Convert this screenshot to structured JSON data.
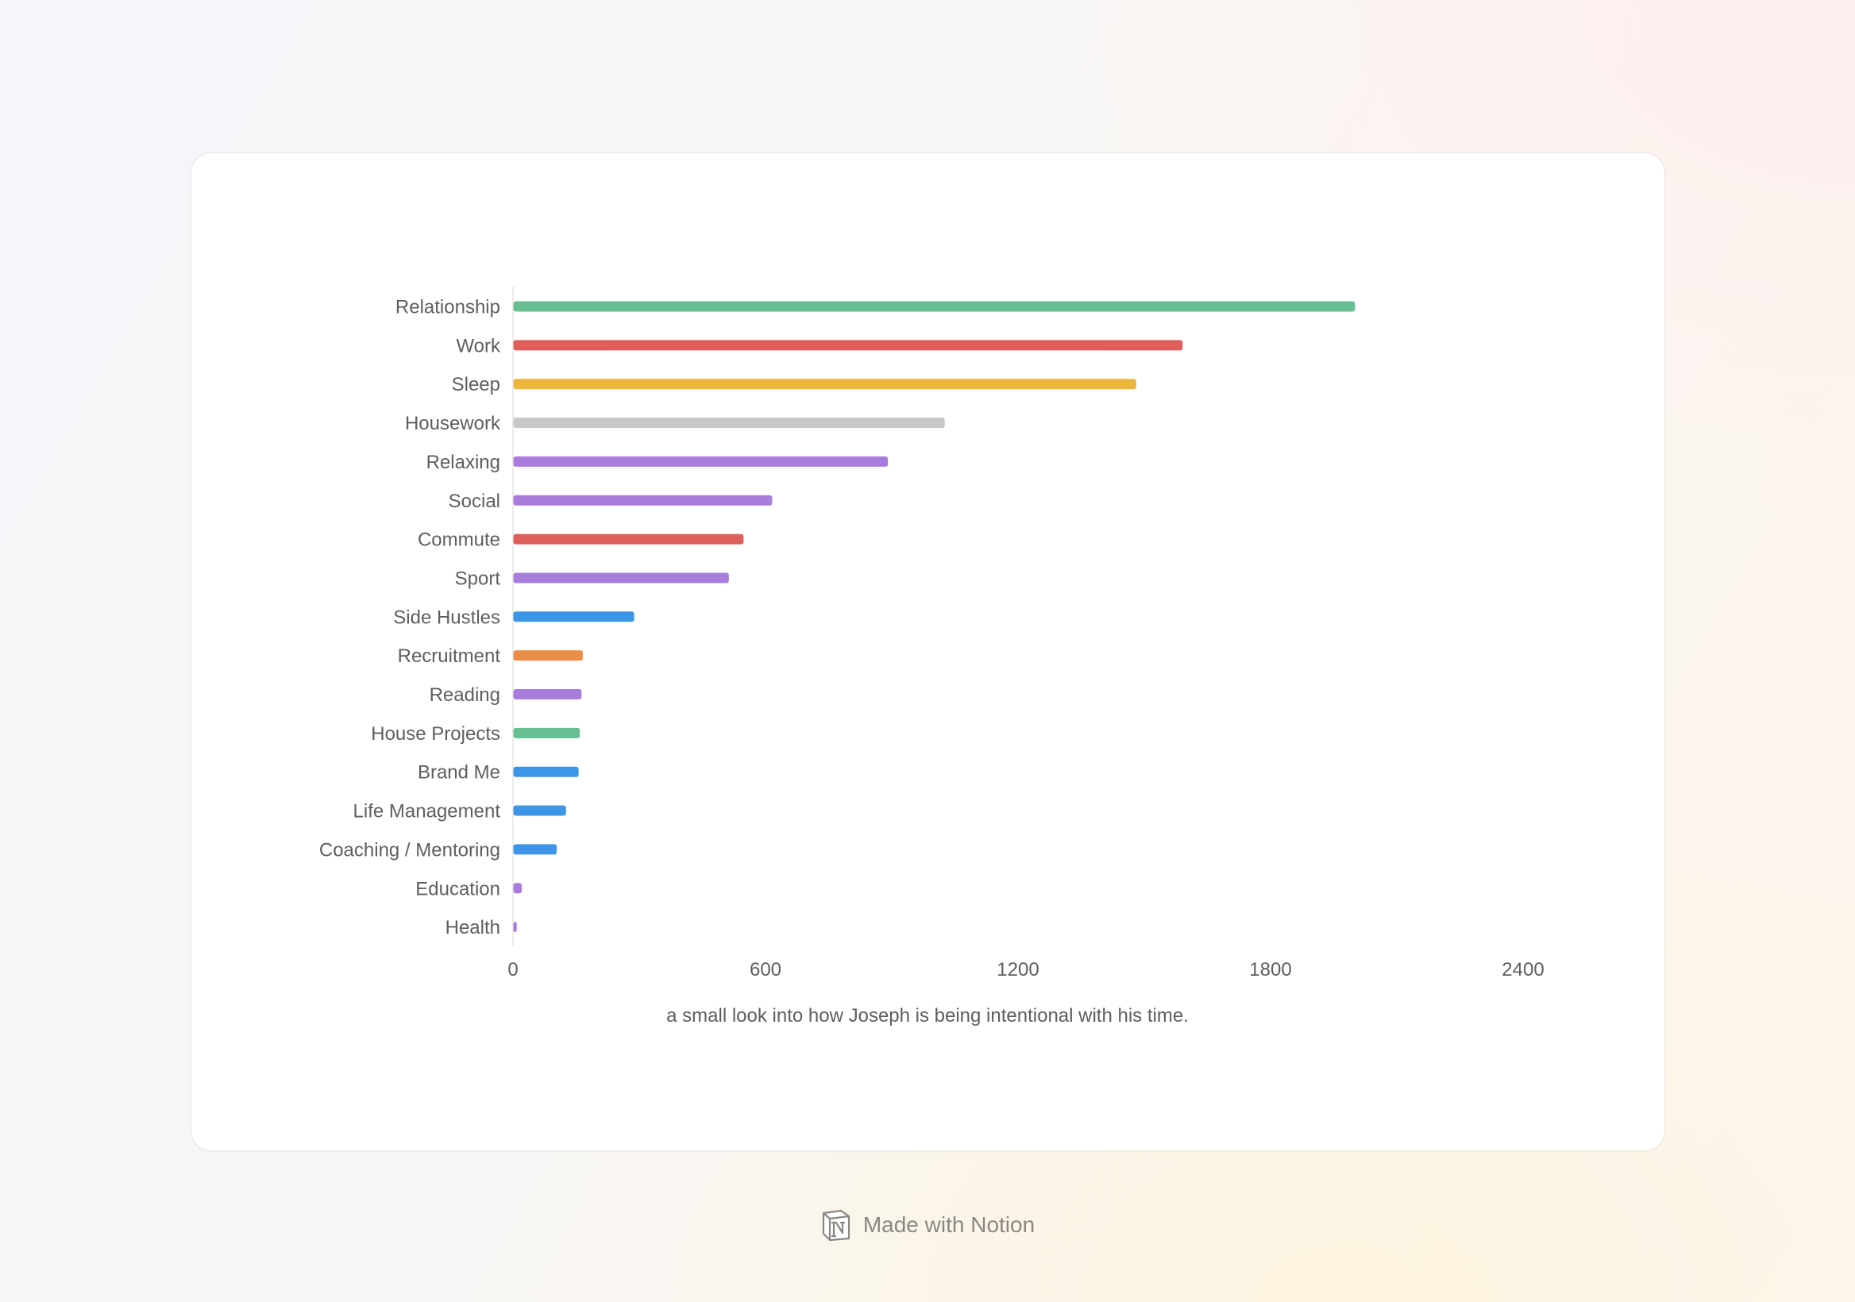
{
  "chart_data": {
    "type": "bar",
    "orientation": "horizontal",
    "caption": "a small look into how Joseph is being intentional with his time.",
    "categories": [
      "Relationship",
      "Work",
      "Sleep",
      "Housework",
      "Relaxing",
      "Social",
      "Commute",
      "Sport",
      "Side Hustles",
      "Recruitment",
      "Reading",
      "House Projects",
      "Brand Me",
      "Life Management",
      "Coaching / Mentoring",
      "Education",
      "Health"
    ],
    "values": [
      2000,
      1590,
      1480,
      1025,
      890,
      615,
      547,
      512,
      287,
      165,
      162,
      158,
      155,
      125,
      103,
      20,
      8
    ],
    "colors": [
      "#66bf91",
      "#df5f5b",
      "#ebb63c",
      "#c9c8c7",
      "#a97ddc",
      "#a97ddc",
      "#df5f5b",
      "#a97ddc",
      "#3d95e7",
      "#ec8d47",
      "#a97ddc",
      "#66bf91",
      "#3d95e7",
      "#3d95e7",
      "#3d95e7",
      "#a97ddc",
      "#a97ddc"
    ],
    "xticks": [
      0,
      600,
      1200,
      1800,
      2400
    ],
    "xlim": [
      0,
      2400
    ],
    "grid": false,
    "legend": "none"
  },
  "footer": {
    "text": "Made with Notion",
    "icon": "notion-logo-icon"
  }
}
